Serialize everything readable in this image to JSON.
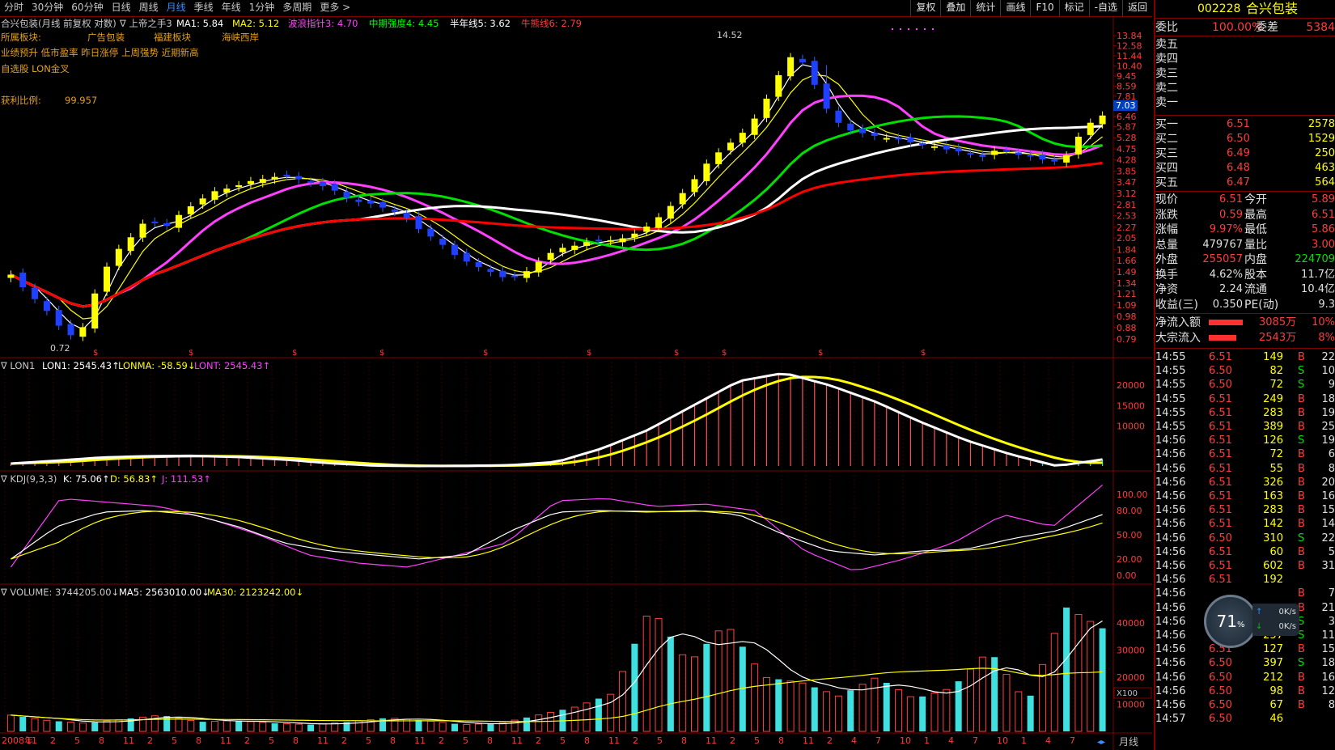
{
  "toolbar": {
    "periods": [
      "分时",
      "30分钟",
      "60分钟",
      "日线",
      "周线",
      "月线",
      "季线",
      "年线",
      "1分钟",
      "多周期",
      "更多 >"
    ],
    "active_period": "月线",
    "right_tools": [
      "复权",
      "叠加",
      "统计",
      "画线",
      "F10",
      "标记",
      "-自选",
      "返回"
    ]
  },
  "main_legend": {
    "title": "合兴包装(月线 前复权 对数)",
    "indicator": "∇ 上帝之手3",
    "ma1": "MA1: 5.84",
    "ma2": "MA2: 5.12",
    "ma3": "波浪指针3: 4.70",
    "ma4": "中期强度4: 4.45",
    "ma5": "半年线5: 3.62",
    "ma6": "牛熊线6: 2.79"
  },
  "info": {
    "sector_label": "所属板块:",
    "sectors": [
      "广告包装",
      "福建板块",
      "海峡西岸"
    ],
    "tags": "业绩预升 低市盈率 昨日涨停 上周强势 近期新高",
    "tags2": "自选股 LON金叉",
    "profit_label": "获利比例:",
    "profit_value": "99.957"
  },
  "price_axis": [
    "13.84",
    "12.58",
    "11.44",
    "10.40",
    "9.45",
    "8.59",
    "7.81",
    "7.10",
    "6.46",
    "5.87",
    "5.28",
    "4.75",
    "4.28",
    "3.85",
    "3.47",
    "3.12",
    "2.81",
    "2.53",
    "2.27",
    "2.05",
    "1.84",
    "1.66",
    "1.49",
    "1.34",
    "1.21",
    "1.09",
    "0.98",
    "0.88",
    "0.79"
  ],
  "price_marker": "7.03",
  "high_label": "14.52",
  "low_label": "0.72",
  "lon_legend": {
    "name": "∇ LON1",
    "lon1": "LON1: 2545.43↑",
    "lonma": "LONMA: -58.59↓",
    "lont": "LONT: 2545.43↑"
  },
  "lon_axis": [
    "20000",
    "15000",
    "10000"
  ],
  "kdj_legend": {
    "name": "∇ KDJ(9,3,3)",
    "k": "K: 75.06↑",
    "d": "D: 56.83↑",
    "j": "J: 111.53↑"
  },
  "kdj_axis": [
    "100.00",
    "80.00",
    "50.00",
    "20.00",
    "0.00"
  ],
  "vol_legend": {
    "name": "∇ VOLUME: 3744205.00↓",
    "ma5": "MA5: 2563010.00↓",
    "ma30": "MA30: 2123242.00↓"
  },
  "vol_axis": [
    "40000",
    "30000",
    "20000",
    "10000"
  ],
  "vol_unit": "X100",
  "x_axis": [
    "2008年",
    "11",
    "2",
    "5",
    "8",
    "11",
    "2",
    "5",
    "8",
    "11",
    "2",
    "5",
    "8",
    "11",
    "2",
    "5",
    "8",
    "11",
    "2",
    "5",
    "8",
    "11",
    "2",
    "5",
    "8",
    "11",
    "2",
    "5",
    "8",
    "11",
    "2",
    "5",
    "8",
    "11",
    "2",
    "4",
    "7",
    "10",
    "1",
    "4",
    "7",
    "10",
    "1",
    "4",
    "7"
  ],
  "bottom_right": "月线",
  "quote": {
    "code": "002228",
    "name": "合兴包装",
    "weibi_label": "委比",
    "weibi": "100.00%",
    "weicha_label": "委差",
    "weicha": "5384",
    "sells": [
      "卖五",
      "卖四",
      "卖三",
      "卖二",
      "卖一"
    ],
    "buys": [
      {
        "label": "买一",
        "price": "6.51",
        "vol": "2578"
      },
      {
        "label": "买二",
        "price": "6.50",
        "vol": "1529"
      },
      {
        "label": "买三",
        "price": "6.49",
        "vol": "250"
      },
      {
        "label": "买四",
        "price": "6.48",
        "vol": "463"
      },
      {
        "label": "买五",
        "price": "6.47",
        "vol": "564"
      }
    ],
    "stats": [
      {
        "l1": "现价",
        "v1": "6.51",
        "c1": "red",
        "l2": "今开",
        "v2": "5.89",
        "c2": "red"
      },
      {
        "l1": "涨跌",
        "v1": "0.59",
        "c1": "red",
        "l2": "最高",
        "v2": "6.51",
        "c2": "red"
      },
      {
        "l1": "涨幅",
        "v1": "9.97%",
        "c1": "red",
        "l2": "最低",
        "v2": "5.86",
        "c2": "red"
      },
      {
        "l1": "总量",
        "v1": "479767",
        "c1": "white",
        "l2": "量比",
        "v2": "3.00",
        "c2": "red"
      },
      {
        "l1": "外盘",
        "v1": "255057",
        "c1": "red",
        "l2": "内盘",
        "v2": "224709",
        "c2": "green"
      },
      {
        "l1": "换手",
        "v1": "4.62%",
        "c1": "white",
        "l2": "股本",
        "v2": "11.7亿",
        "c2": "white"
      },
      {
        "l1": "净资",
        "v1": "2.24",
        "c1": "white",
        "l2": "流通",
        "v2": "10.4亿",
        "c2": "white"
      },
      {
        "l1": "收益(三)",
        "v1": "0.350",
        "c1": "white",
        "l2": "PE(动)",
        "v2": "9.3",
        "c2": "white"
      }
    ],
    "flows": [
      {
        "label": "净流入额",
        "value": "3085万",
        "pct": "10%"
      },
      {
        "label": "大宗流入",
        "value": "2543万",
        "pct": "8%"
      }
    ],
    "ticks": [
      {
        "t": "14:55",
        "p": "6.51",
        "v": "149",
        "s": "B",
        "n": "22"
      },
      {
        "t": "14:55",
        "p": "6.50",
        "v": "82",
        "s": "S",
        "n": "10"
      },
      {
        "t": "14:55",
        "p": "6.50",
        "v": "72",
        "s": "S",
        "n": "9"
      },
      {
        "t": "14:55",
        "p": "6.51",
        "v": "249",
        "s": "B",
        "n": "18"
      },
      {
        "t": "14:55",
        "p": "6.51",
        "v": "283",
        "s": "B",
        "n": "19"
      },
      {
        "t": "14:55",
        "p": "6.51",
        "v": "389",
        "s": "B",
        "n": "25"
      },
      {
        "t": "14:56",
        "p": "6.51",
        "v": "126",
        "s": "S",
        "n": "19"
      },
      {
        "t": "14:56",
        "p": "6.51",
        "v": "72",
        "s": "B",
        "n": "6"
      },
      {
        "t": "14:56",
        "p": "6.51",
        "v": "55",
        "s": "B",
        "n": "8"
      },
      {
        "t": "14:56",
        "p": "6.51",
        "v": "326",
        "s": "B",
        "n": "20"
      },
      {
        "t": "14:56",
        "p": "6.51",
        "v": "163",
        "s": "B",
        "n": "16"
      },
      {
        "t": "14:56",
        "p": "6.51",
        "v": "283",
        "s": "B",
        "n": "15"
      },
      {
        "t": "14:56",
        "p": "6.51",
        "v": "142",
        "s": "B",
        "n": "14"
      },
      {
        "t": "14:56",
        "p": "6.50",
        "v": "310",
        "s": "S",
        "n": "22"
      },
      {
        "t": "14:56",
        "p": "6.51",
        "v": "60",
        "s": "B",
        "n": "5"
      },
      {
        "t": "14:56",
        "p": "6.51",
        "v": "602",
        "s": "B",
        "n": "31"
      },
      {
        "t": "14:56",
        "p": "6.51",
        "v": "192",
        "s": "",
        "n": ""
      },
      {
        "t": "14:56",
        "p": "",
        "v": "",
        "s": "B",
        "n": "7"
      },
      {
        "t": "14:56",
        "p": "",
        "v": "",
        "s": "B",
        "n": "21"
      },
      {
        "t": "14:56",
        "p": "6.50",
        "v": "111",
        "s": "S",
        "n": "3"
      },
      {
        "t": "14:56",
        "p": "6.50",
        "v": "257",
        "s": "S",
        "n": "11"
      },
      {
        "t": "14:56",
        "p": "6.51",
        "v": "127",
        "s": "B",
        "n": "15"
      },
      {
        "t": "14:56",
        "p": "6.50",
        "v": "397",
        "s": "S",
        "n": "18"
      },
      {
        "t": "14:56",
        "p": "6.50",
        "v": "212",
        "s": "B",
        "n": "16"
      },
      {
        "t": "14:56",
        "p": "6.50",
        "v": "98",
        "s": "B",
        "n": "12"
      },
      {
        "t": "14:56",
        "p": "6.50",
        "v": "67",
        "s": "B",
        "n": "8"
      },
      {
        "t": "14:57",
        "p": "6.50",
        "v": "46",
        "s": "",
        "n": ""
      }
    ]
  },
  "net_widget": {
    "pct": "71",
    "unit": "%",
    "up": "0K/s",
    "down": "0K/s"
  },
  "colors": {
    "up": "#ff3c3c",
    "down": "#00e000",
    "border": "#800000",
    "ma1": "#ffffff",
    "ma2": "#ffff00",
    "ma3": "#ff40ff",
    "ma4": "#00ff00",
    "ma5": "#ffffff",
    "ma6": "#ff0000"
  },
  "chart_data": [
    {
      "type": "candlestick",
      "title": "合兴包装(月线 前复权 对数)",
      "y_scale": "log",
      "ylim": [
        0.79,
        13.84
      ],
      "series": [
        {
          "name": "close",
          "values": [
            1.45,
            1.22,
            1.05,
            0.86,
            0.78,
            1.25,
            1.75,
            2.05,
            2.45,
            2.25,
            2.6,
            2.9,
            3.2,
            3.3,
            3.5,
            3.6,
            3.7,
            3.55,
            3.4,
            3.2,
            2.9,
            2.85,
            2.7,
            2.55,
            2.2,
            2.0,
            1.75,
            1.6,
            1.5,
            1.4,
            1.45,
            1.65,
            1.85,
            1.9,
            2.0,
            2.0,
            2.05,
            2.2,
            2.5,
            2.9,
            3.5,
            4.3,
            4.9,
            5.6,
            6.8,
            9.5,
            12.0,
            9.0,
            6.5,
            5.7,
            5.5,
            5.3,
            5.2,
            5.0,
            4.9,
            4.7,
            4.6,
            4.4,
            4.8,
            4.5,
            4.4,
            4.2,
            4.5,
            5.9,
            6.51
          ]
        }
      ]
    },
    {
      "type": "line",
      "title": "LON",
      "series": [
        {
          "name": "LON1"
        },
        {
          "name": "LONMA"
        }
      ]
    },
    {
      "type": "line",
      "title": "KDJ(9,3,3)",
      "ylim": [
        0,
        100
      ],
      "series": [
        {
          "name": "K",
          "values": [
            20,
            60,
            78,
            80,
            75,
            60,
            40,
            30,
            25,
            20,
            25,
            55,
            78,
            80,
            78,
            80,
            75,
            50,
            30,
            25,
            30,
            32,
            45,
            55,
            75
          ]
        },
        {
          "name": "J",
          "values": [
            10,
            95,
            90,
            85,
            70,
            50,
            25,
            15,
            10,
            25,
            40,
            92,
            95,
            85,
            88,
            80,
            30,
            5,
            20,
            40,
            75,
            60,
            111.53
          ]
        }
      ]
    },
    {
      "type": "bar",
      "title": "VOLUME",
      "ylim": [
        0,
        48000
      ]
    }
  ]
}
